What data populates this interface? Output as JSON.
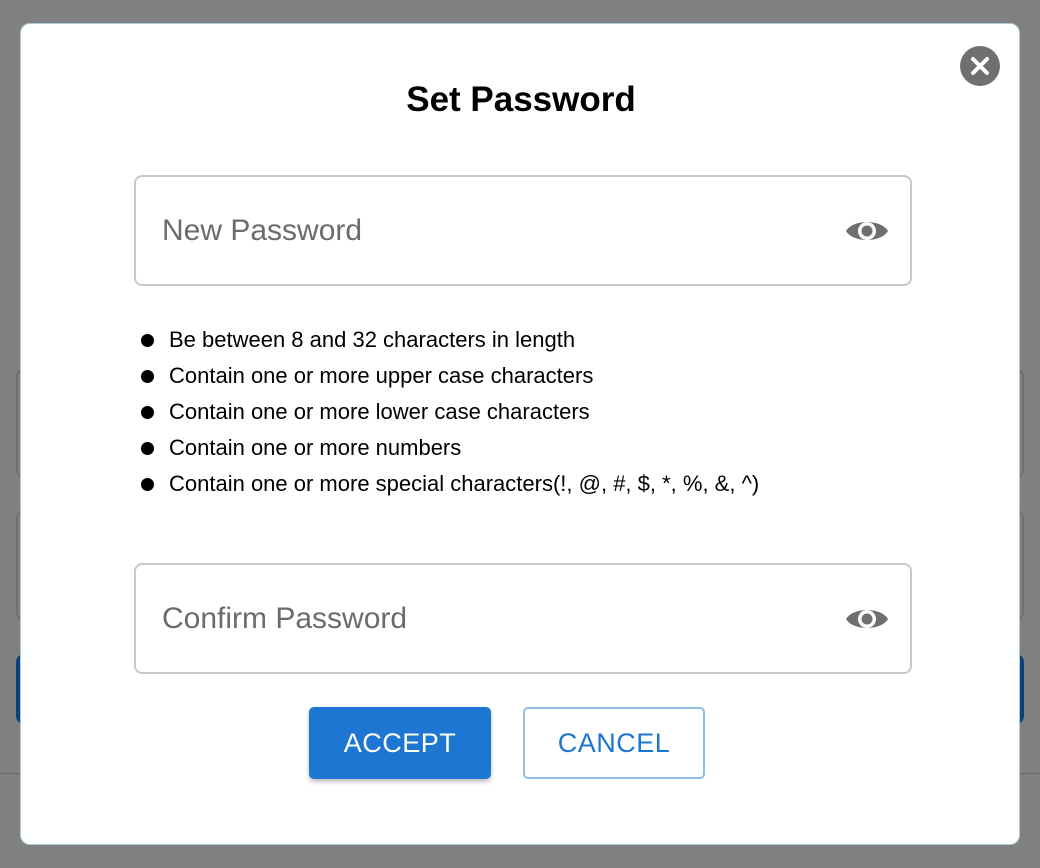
{
  "dialog": {
    "title": "Set Password",
    "close_icon": "close-circle-icon",
    "new_password": {
      "placeholder": "New Password",
      "value": "",
      "toggle_icon": "eye-icon"
    },
    "requirements": [
      "Be between 8 and 32 characters in length",
      "Contain one or more upper case characters",
      "Contain one or more lower case characters",
      "Contain one or more numbers",
      "Contain one or more special characters(!, @, #, $, *, %, &, ^)"
    ],
    "confirm_password": {
      "placeholder": "Confirm Password",
      "value": "",
      "toggle_icon": "eye-icon"
    },
    "buttons": {
      "accept_label": "ACCEPT",
      "cancel_label": "CANCEL"
    }
  },
  "colors": {
    "accent": "#1c76d2",
    "overlay": "#808080",
    "icon_gray": "#6f6f6f"
  }
}
